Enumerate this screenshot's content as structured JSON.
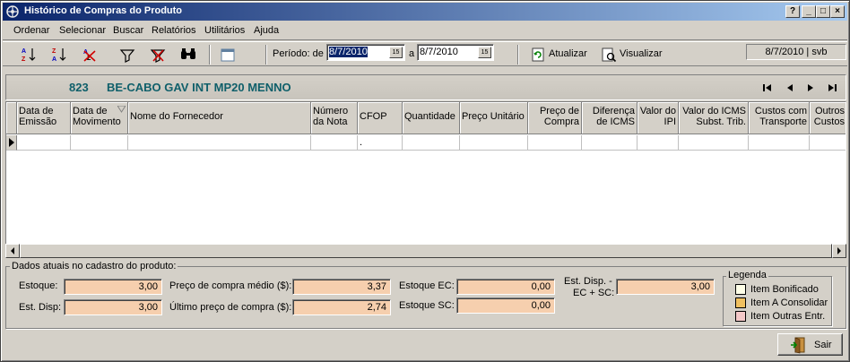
{
  "window": {
    "title": "Histórico de Compras do Produto",
    "controls": [
      "?",
      "_",
      "□",
      "×"
    ]
  },
  "menu": {
    "items": [
      {
        "label": "Ordenar",
        "key": "O"
      },
      {
        "label": "Selecionar",
        "key": "S"
      },
      {
        "label": "Buscar",
        "key": "B"
      },
      {
        "label": "Relatórios",
        "key": "R"
      },
      {
        "label": "Utilitários",
        "key": "U"
      },
      {
        "label": "Ajuda",
        "key": "A"
      }
    ],
    "status": "8/7/2010 | svb"
  },
  "toolbar": {
    "period_label": "Período: de",
    "date_from": "8/7/2010",
    "to_label": "a",
    "date_to": "8/7/2010",
    "refresh_label": "Atualizar",
    "view_label": "Visualizar"
  },
  "product": {
    "code": "823",
    "name": "BE-CABO GAV INT MP20 MENNO"
  },
  "grid": {
    "columns": [
      "Data de Emissão",
      "Data de Movimento",
      "Nome do Fornecedor",
      "Número da Nota",
      "CFOP",
      "Quantidade",
      "Preço Unitário",
      "Preço de Compra",
      "Diferença de ICMS",
      "Valor do IPI",
      "Valor do ICMS Subst. Trib.",
      "Custos com Transporte",
      "Outros Custos"
    ],
    "row": {
      "cfop": "."
    }
  },
  "details": {
    "group_title": "Dados atuais no cadastro do produto:",
    "estoque_label": "Estoque:",
    "estoque": "3,00",
    "est_disp_label": "Est. Disp:",
    "est_disp": "3,00",
    "preco_medio_label": "Preço de compra médio ($):",
    "preco_medio": "3,37",
    "ultimo_preco_label": "Último preço de compra ($):",
    "ultimo_preco": "2,74",
    "estoque_ec_label": "Estoque EC:",
    "estoque_ec": "0,00",
    "estoque_sc_label": "Estoque SC:",
    "estoque_sc": "0,00",
    "est_disp_ecsc_label_1": "Est. Disp. -",
    "est_disp_ecsc_label_2": "EC + SC:",
    "est_disp_ecsc": "3,00"
  },
  "legend": {
    "title": "Legenda",
    "items": [
      {
        "label": "Item Bonificado",
        "color": "#ffffe8"
      },
      {
        "label": "Item A Consolidar",
        "color": "#f0c060"
      },
      {
        "label": "Item Outras Entr.",
        "color": "#f4c8c8"
      }
    ]
  },
  "footer": {
    "exit_label": "Sair"
  }
}
